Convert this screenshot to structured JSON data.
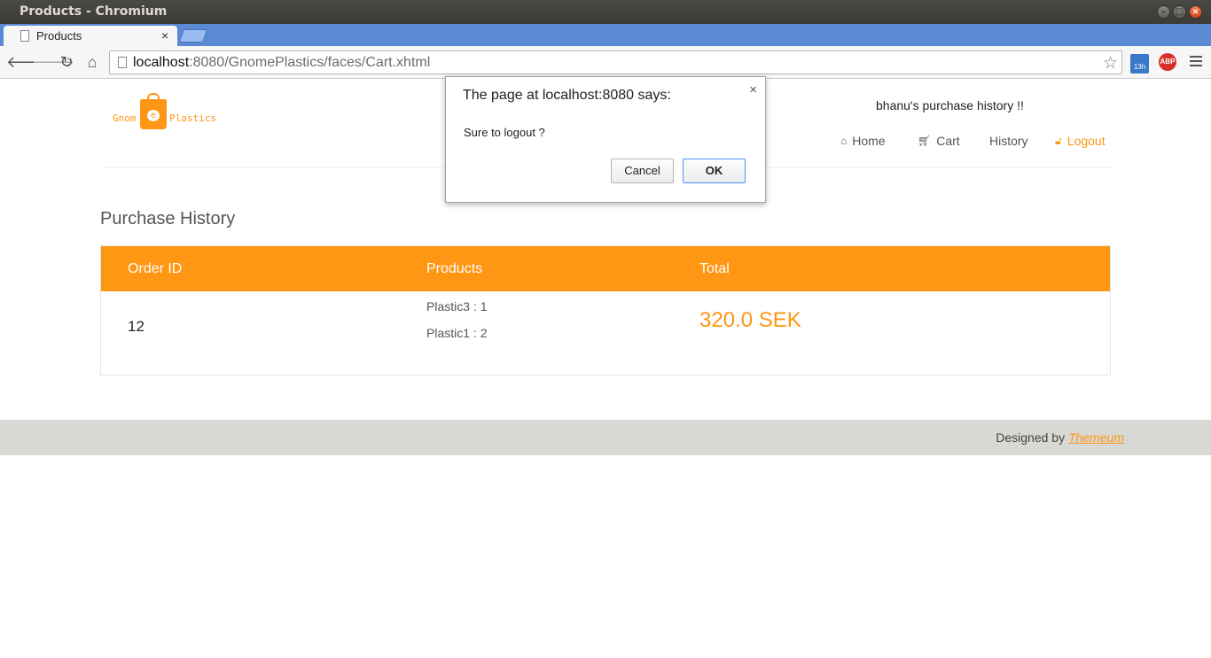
{
  "window": {
    "title": "Products - Chromium"
  },
  "tab": {
    "title": "Products"
  },
  "address": {
    "host": "localhost",
    "rest": ":8080/GnomePlastics/faces/Cart.xhtml"
  },
  "extensions": {
    "calendar_label": "13h",
    "adblock_label": "ABP"
  },
  "logo": {
    "left": "Gnom",
    "middle": "e",
    "right": "Plastics"
  },
  "header": {
    "greeting": "bhanu's purchase history !!",
    "nav": [
      {
        "label": "Home",
        "icon": "home-icon"
      },
      {
        "label": "Cart",
        "icon": "cart-icon"
      },
      {
        "label": "History",
        "icon": ""
      },
      {
        "label": "Logout",
        "icon": "unlock-icon"
      }
    ]
  },
  "main": {
    "title": "Purchase History",
    "table": {
      "columns": [
        "Order ID",
        "Products",
        "Total"
      ],
      "rows": [
        {
          "order_id": "12",
          "products": [
            "Plastic3 : 1",
            "Plastic1 : 2"
          ],
          "total": "320.0 SEK"
        }
      ]
    }
  },
  "footer": {
    "prefix": "Designed by ",
    "link": "Themeum"
  },
  "dialog": {
    "title": "The page at localhost:8080 says:",
    "message": "Sure to logout ?",
    "cancel": "Cancel",
    "ok": "OK"
  },
  "colors": {
    "accent": "#ff9614",
    "tabstrip": "#5a8ad3",
    "footer": "#d8d9d4"
  }
}
